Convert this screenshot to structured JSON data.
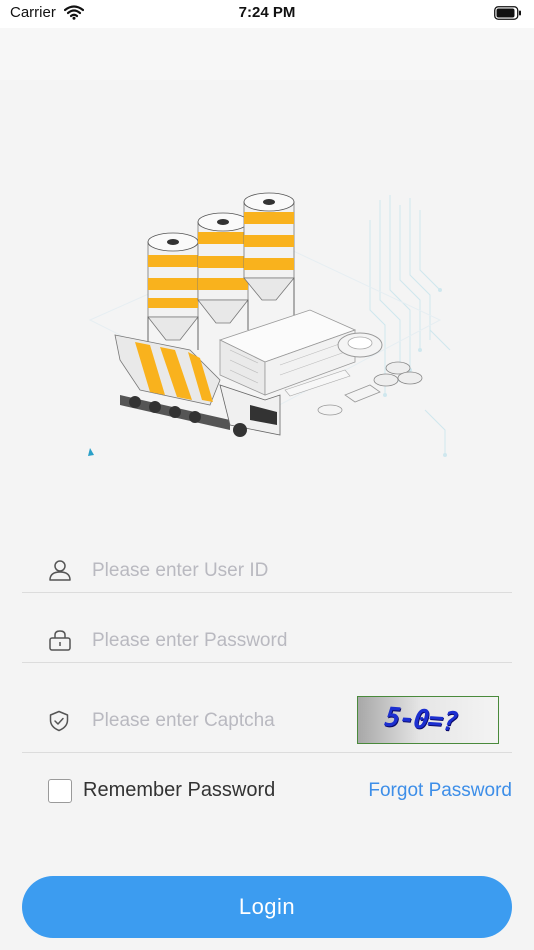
{
  "status_bar": {
    "carrier": "Carrier",
    "time": "7:24 PM",
    "wifi_icon": "wifi-icon",
    "battery_icon": "battery-icon"
  },
  "illustration": {
    "icon": "concrete-plant-illustration"
  },
  "login_form": {
    "user_id": {
      "icon": "user-icon",
      "value": "",
      "placeholder": "Please enter User ID"
    },
    "password": {
      "icon": "lock-icon",
      "value": "",
      "placeholder": "Please enter Password"
    },
    "captcha": {
      "icon": "shield-check-icon",
      "value": "",
      "placeholder": "Please enter Captcha",
      "image_text": "5-0=?"
    },
    "remember_password": {
      "label": "Remember Password",
      "checked": false
    },
    "forgot_password_label": "Forgot Password",
    "login_label": "Login"
  },
  "colors": {
    "accent": "#3c9cf0",
    "link": "#3d8ee8",
    "background": "#f4f4f4",
    "illustration_yellow": "#f9b21d"
  }
}
